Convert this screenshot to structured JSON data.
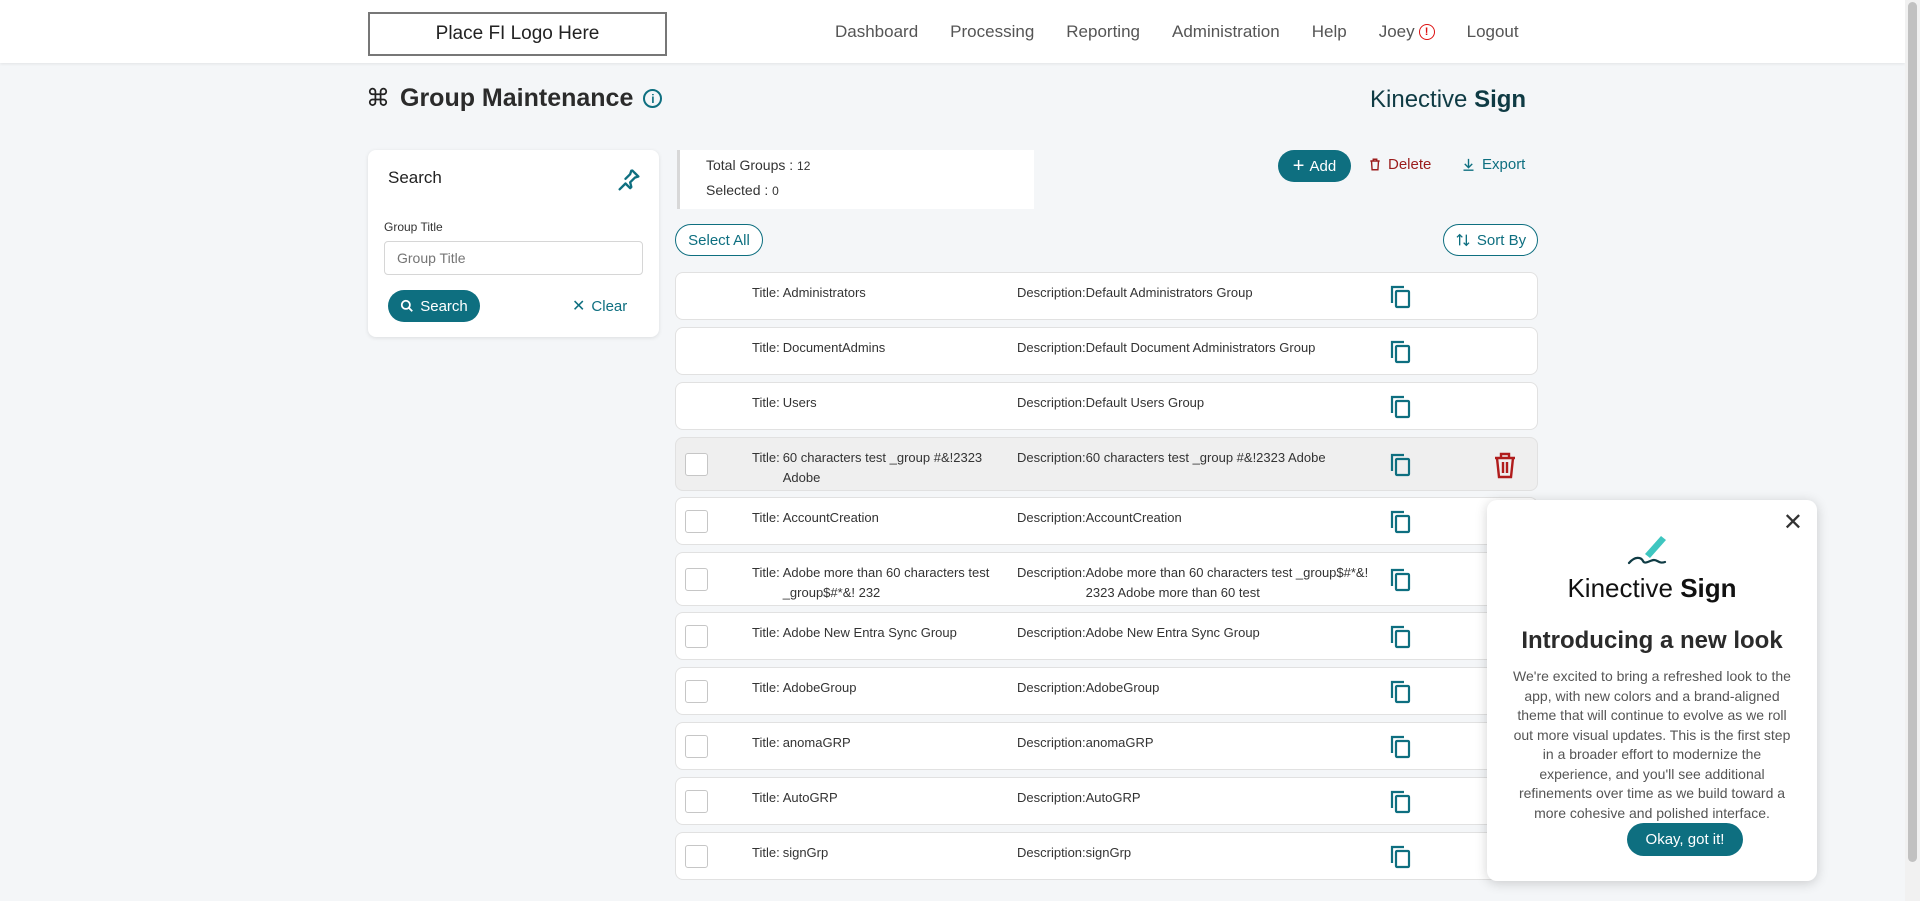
{
  "header": {
    "logo_placeholder": "Place FI Logo Here",
    "nav": [
      "Dashboard",
      "Processing",
      "Reporting",
      "Administration",
      "Help"
    ],
    "user": "Joey",
    "logout": "Logout"
  },
  "page": {
    "title": "Group Maintenance",
    "brand_light": "Kinective ",
    "brand_bold": "Sign"
  },
  "search": {
    "title": "Search",
    "field_label": "Group Title",
    "placeholder": "Group Title",
    "search_button": "Search",
    "clear_button": "Clear"
  },
  "summary": {
    "total_label": "Total Groups : ",
    "total_value": "12",
    "selected_label": "Selected : ",
    "selected_value": "0"
  },
  "toolbar": {
    "add": "Add",
    "delete": "Delete",
    "export": "Export",
    "select_all": "Select All",
    "sort_by": "Sort By"
  },
  "groups": [
    {
      "title_prefix": "Title: ",
      "title": "Administrators",
      "desc_prefix": "Description:",
      "description": "Default Administrators Group"
    },
    {
      "title_prefix": "Title: ",
      "title": "DocumentAdmins",
      "desc_prefix": "Description:",
      "description": "Default Document Administrators Group"
    },
    {
      "title_prefix": "Title: ",
      "title": "Users",
      "desc_prefix": "Description:",
      "description": "Default Users Group"
    },
    {
      "title_prefix": "Title: ",
      "title": "60 characters test _group #&!2323 Adobe",
      "desc_prefix": "Description:",
      "description": "60 characters test _group #&!2323 Adobe"
    },
    {
      "title_prefix": "Title: ",
      "title": "AccountCreation",
      "desc_prefix": "Description:",
      "description": "AccountCreation"
    },
    {
      "title_prefix": "Title: ",
      "title": "Adobe more than 60 characters test _group$#*&! 232",
      "desc_prefix": "Description:",
      "description": "Adobe more than 60 characters test _group$#*&! 2323 Adobe more than 60 test"
    },
    {
      "title_prefix": "Title: ",
      "title": "Adobe New Entra Sync Group",
      "desc_prefix": "Description:",
      "description": "Adobe New Entra Sync Group"
    },
    {
      "title_prefix": "Title: ",
      "title": "AdobeGroup",
      "desc_prefix": "Description:",
      "description": "AdobeGroup"
    },
    {
      "title_prefix": "Title: ",
      "title": "anomaGRP",
      "desc_prefix": "Description:",
      "description": "anomaGRP"
    },
    {
      "title_prefix": "Title: ",
      "title": "AutoGRP",
      "desc_prefix": "Description:",
      "description": "AutoGRP"
    },
    {
      "title_prefix": "Title: ",
      "title": "signGrp",
      "desc_prefix": "Description:",
      "description": "signGrp"
    }
  ],
  "popup": {
    "brand_light": "Kinective ",
    "brand_bold": "Sign",
    "heading": "Introducing a new look",
    "body": "We're excited to bring a refreshed look to the app, with new colors and a brand-aligned theme that will continue to evolve as we roll out more visual updates. This is the first step in a broader effort to modernize the experience, and you'll see additional refinements over time as we build toward a more cohesive and polished interface.",
    "ok_button": "Okay, got it!"
  },
  "colors": {
    "accent": "#0e6f80",
    "danger": "#9b1c1c",
    "brand_dark": "#0f3b44"
  },
  "icons": {
    "title": "command-icon",
    "info": "info-icon",
    "pin": "pin-icon",
    "search": "search-icon",
    "clear": "close-icon",
    "add": "plus-icon",
    "delete": "trash-icon",
    "export": "download-icon",
    "sort": "sort-icon",
    "row_copy": "copy-icon",
    "popup_close": "close-icon",
    "popup_logo": "pen-signature-icon",
    "user_alert": "alert-icon"
  }
}
